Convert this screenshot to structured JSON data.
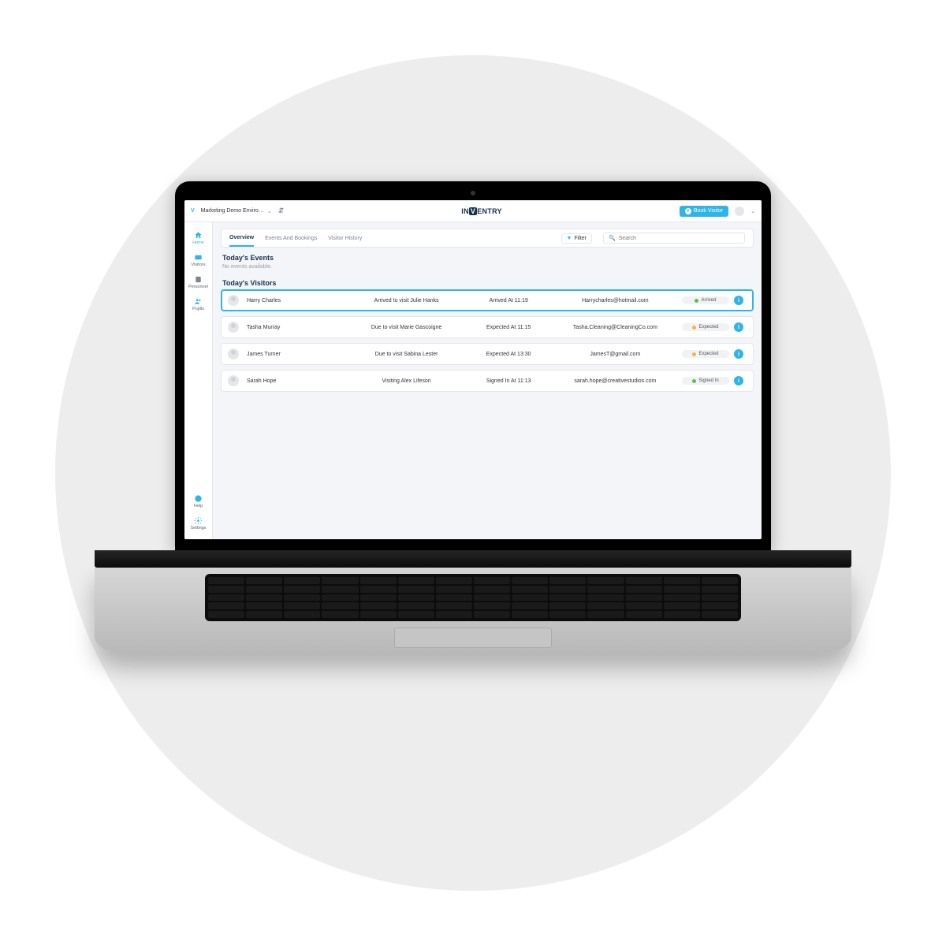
{
  "topbar": {
    "environment": "Marketing Demo Enviro…",
    "logo_prefix": "IN",
    "logo_v": "V",
    "logo_suffix": "ENTRY",
    "book_visitor_label": "Book Visitor"
  },
  "sidebar": {
    "items": [
      {
        "label": "Home",
        "icon": "home-icon"
      },
      {
        "label": "Visitors",
        "icon": "id-card-icon"
      },
      {
        "label": "Personnel",
        "icon": "badge-icon"
      },
      {
        "label": "Pupils",
        "icon": "users-icon"
      }
    ],
    "bottom": [
      {
        "label": "Help",
        "icon": "help-icon"
      },
      {
        "label": "Settings",
        "icon": "gear-icon"
      }
    ]
  },
  "tabs": {
    "items": [
      {
        "label": "Overview",
        "active": true
      },
      {
        "label": "Events And Bookings",
        "active": false
      },
      {
        "label": "Visitor History",
        "active": false
      }
    ],
    "filter_label": "Filter",
    "search_placeholder": "Search"
  },
  "sections": {
    "events_title": "Today's Events",
    "events_empty": "No events available.",
    "visitors_title": "Today's Visitors"
  },
  "visitors": [
    {
      "name": "Harry Charles",
      "purpose": "Arrived to visit Julie Hanks",
      "time": "Arrived At 11:19",
      "email": "Harrycharles@hotmail.com",
      "status": "Arrived",
      "status_color": "green",
      "selected": true
    },
    {
      "name": "Tasha Murray",
      "purpose": "Due to visit Marie Gascoigne",
      "time": "Expected At 11:15",
      "email": "Tasha.Cleaning@CleaningCo.com",
      "status": "Expected",
      "status_color": "amber",
      "selected": false
    },
    {
      "name": "James Turner",
      "purpose": "Due to visit Sabina Lester",
      "time": "Expected At 13:30",
      "email": "JamesT@gmail.com",
      "status": "Expected",
      "status_color": "amber",
      "selected": false
    },
    {
      "name": "Sarah Hope",
      "purpose": "Visiting Alex Lifeson",
      "time": "Signed In At 11:13",
      "email": "sarah.hope@creativestudios.com",
      "status": "Signed In",
      "status_color": "green",
      "selected": false
    }
  ],
  "colors": {
    "brand_blue": "#2fb4e9",
    "navy": "#16324a",
    "bg_circle": "#ededed"
  }
}
